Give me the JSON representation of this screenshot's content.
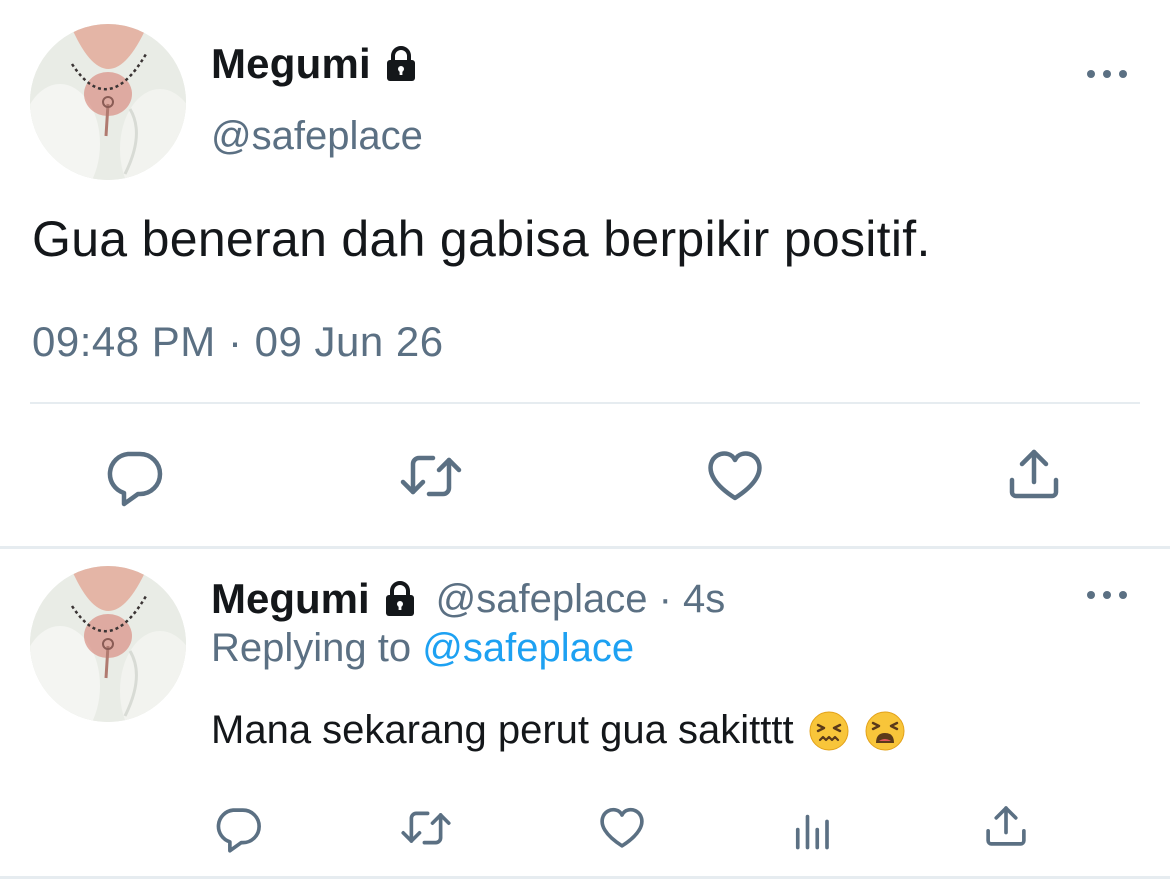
{
  "main_tweet": {
    "display_name": "Megumi",
    "handle": "@safeplace",
    "text": "Gua beneran dah gabisa berpikir positif.",
    "timestamp": "09:48 PM · 09 Jun 26",
    "icons": {
      "protected": "lock-icon",
      "more": "more-options-icon",
      "reply": "reply-icon",
      "retweet": "retweet-icon",
      "like": "heart-icon",
      "share": "share-icon"
    }
  },
  "reply_tweet": {
    "display_name": "Megumi",
    "handle_time": "@safeplace · 4s",
    "replying_prefix": "Replying to",
    "replying_mention": "@safeplace",
    "text": "Mana sekarang perut gua sakitttt",
    "emojis": [
      "confounded-face-emoji",
      "weary-face-emoji"
    ],
    "icons": {
      "reply": "reply-icon",
      "retweet": "retweet-icon",
      "like": "heart-icon",
      "stats": "analytics-icon",
      "share": "share-icon"
    }
  },
  "colors": {
    "text": "#14171a",
    "secondary": "#5b7083",
    "link": "#1da1f2",
    "divider": "#e6ecf0"
  }
}
